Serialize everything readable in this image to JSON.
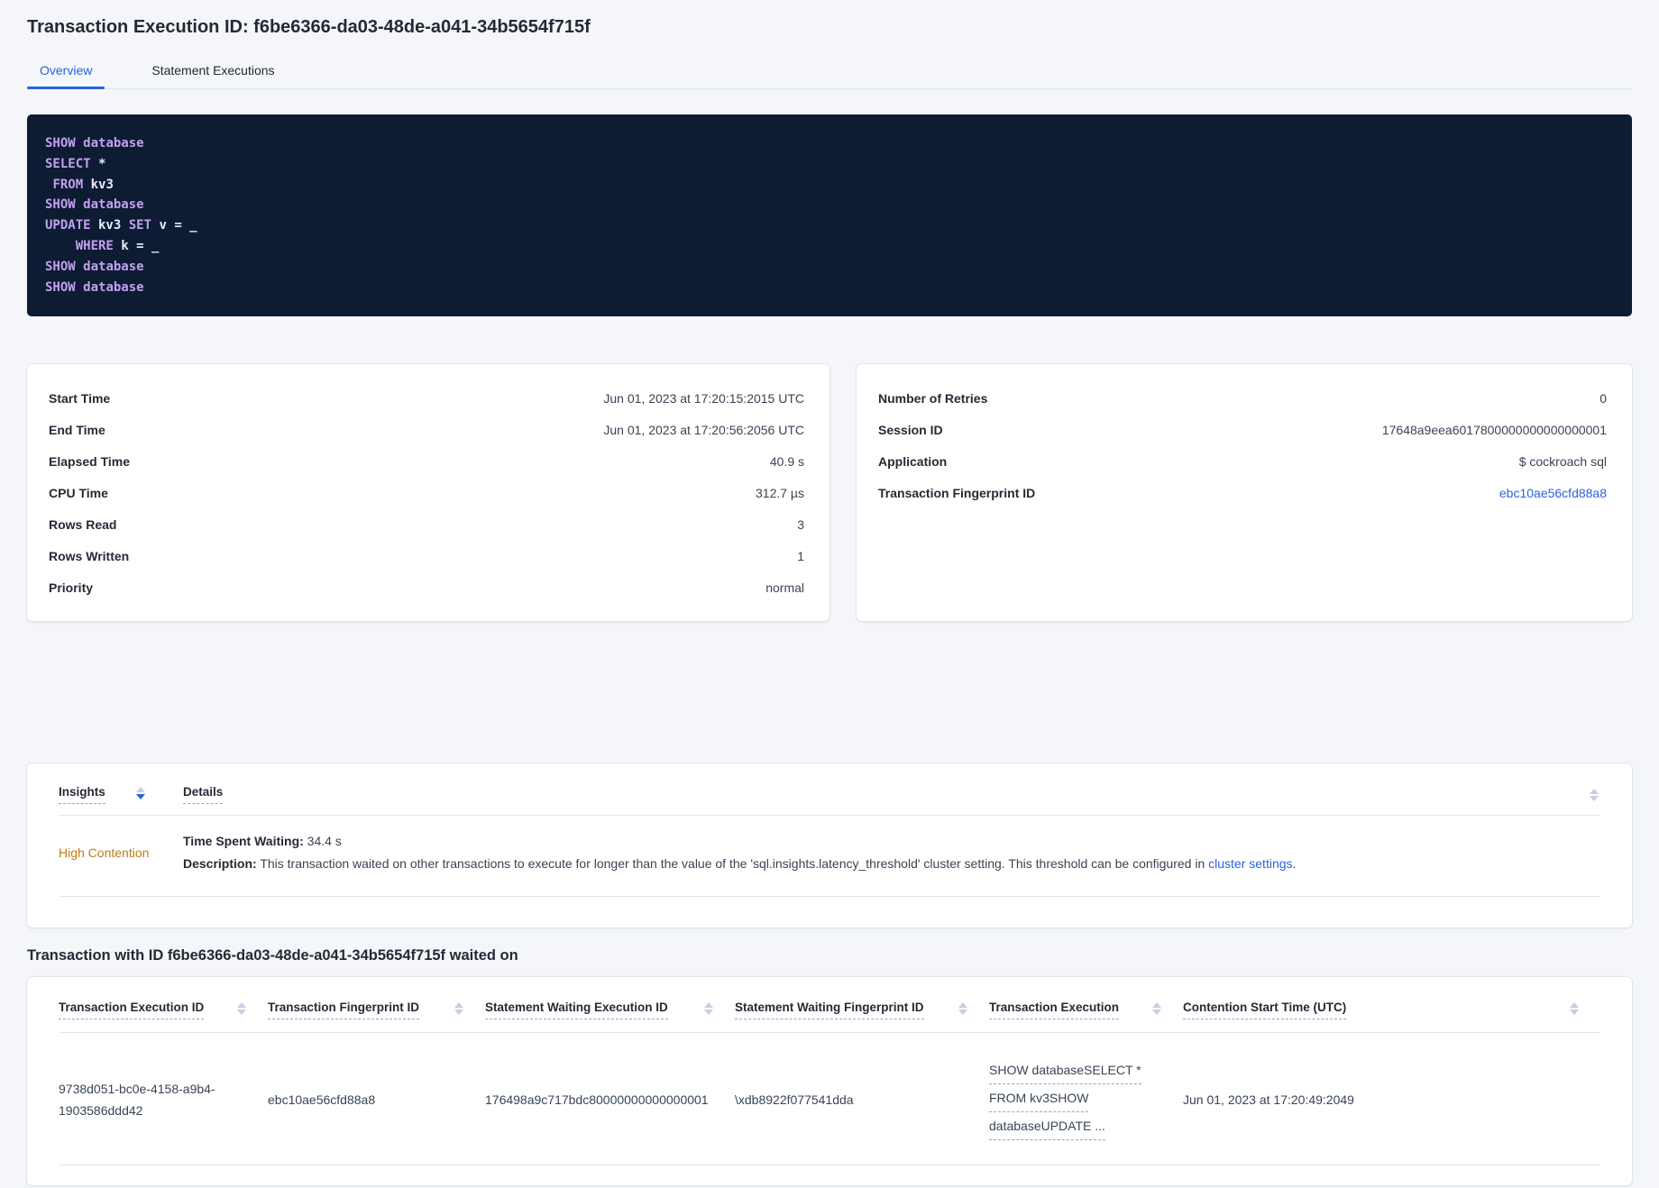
{
  "header": {
    "title": "Transaction Execution ID: f6be6366-da03-48de-a041-34b5654f715f",
    "tabs": [
      {
        "label": "Overview"
      },
      {
        "label": "Statement Executions"
      }
    ]
  },
  "sql": {
    "lines": [
      [
        {
          "c": "kw",
          "t": "SHOW"
        },
        {
          "c": "pl",
          "t": " "
        },
        {
          "c": "kw",
          "t": "database"
        }
      ],
      [
        {
          "c": "kw",
          "t": "SELECT"
        },
        {
          "c": "pl",
          "t": " *"
        }
      ],
      [
        {
          "c": "pl",
          "t": " "
        },
        {
          "c": "kw",
          "t": "FROM"
        },
        {
          "c": "pl",
          "t": " kv3"
        }
      ],
      [
        {
          "c": "kw",
          "t": "SHOW"
        },
        {
          "c": "pl",
          "t": " "
        },
        {
          "c": "kw",
          "t": "database"
        }
      ],
      [
        {
          "c": "kw",
          "t": "UPDATE"
        },
        {
          "c": "pl",
          "t": " kv3 "
        },
        {
          "c": "kw",
          "t": "SET"
        },
        {
          "c": "pl",
          "t": " v = _"
        }
      ],
      [
        {
          "c": "pl",
          "t": "    "
        },
        {
          "c": "kw",
          "t": "WHERE"
        },
        {
          "c": "pl",
          "t": " k = _"
        }
      ],
      [
        {
          "c": "kw",
          "t": "SHOW"
        },
        {
          "c": "pl",
          "t": " "
        },
        {
          "c": "kw",
          "t": "database"
        }
      ],
      [
        {
          "c": "kw",
          "t": "SHOW"
        },
        {
          "c": "pl",
          "t": " "
        },
        {
          "c": "kw",
          "t": "database"
        }
      ]
    ]
  },
  "summary_left": {
    "rows": [
      {
        "label": "Start Time",
        "value": "Jun 01, 2023 at 17:20:15:2015 UTC"
      },
      {
        "label": "End Time",
        "value": "Jun 01, 2023 at 17:20:56:2056 UTC"
      },
      {
        "label": "Elapsed Time",
        "value": "40.9 s"
      },
      {
        "label": "CPU Time",
        "value": "312.7 µs"
      },
      {
        "label": "Rows Read",
        "value": "3"
      },
      {
        "label": "Rows Written",
        "value": "1"
      },
      {
        "label": "Priority",
        "value": "normal"
      }
    ]
  },
  "summary_right": {
    "rows": [
      {
        "label": "Number of Retries",
        "value": "0"
      },
      {
        "label": "Session ID",
        "value": "17648a9eea6017800000000000000001"
      },
      {
        "label": "Application",
        "value": "$ cockroach sql"
      },
      {
        "label": "Transaction Fingerprint ID",
        "value": "ebc10ae56cfd88a8"
      }
    ]
  },
  "insights": {
    "col_insights": "Insights",
    "col_details": "Details",
    "row": {
      "insight": "High Contention",
      "waiting_label": "Time Spent Waiting:",
      "waiting_value": " 34.4 s",
      "desc_label": "Description:",
      "desc_text": " This transaction waited on other transactions to execute for longer than the value of the 'sql.insights.latency_threshold' cluster setting. This threshold can be configured in ",
      "desc_link": "cluster settings",
      "desc_suffix": "."
    }
  },
  "waited_on": {
    "heading": "Transaction with ID f6be6366-da03-48de-a041-34b5654f715f waited on",
    "columns": [
      "Transaction Execution ID",
      "Transaction Fingerprint ID",
      "Statement Waiting Execution ID",
      "Statement Waiting Fingerprint ID",
      "Transaction Execution",
      "Contention Start Time (UTC)"
    ],
    "row": {
      "txn_execution_id": "9738d051-bc0e-4158-a9b4-1903586ddd42",
      "txn_fingerprint_id": "ebc10ae56cfd88a8",
      "stmt_waiting_execution_id": "176498a9c717bdc80000000000000001",
      "stmt_waiting_fingerprint_id": "\\xdb8922f077541dda",
      "txn_execution_lines": [
        "SHOW databaseSELECT *",
        "FROM kv3SHOW",
        "databaseUPDATE ..."
      ],
      "contention_start_time": "Jun 01, 2023 at 17:20:49:2049"
    }
  },
  "colors": {
    "accent_blue": "#2a63dd",
    "insight_orange": "#bf7b16",
    "code_bg": "#0d1b33",
    "code_keyword": "#c2a1ee"
  }
}
